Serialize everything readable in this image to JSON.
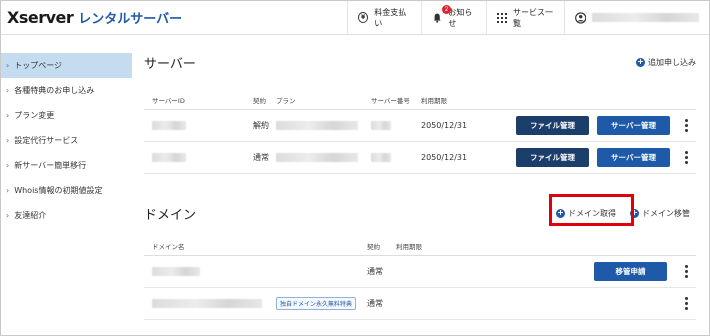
{
  "header": {
    "logo_main": "Xserver",
    "logo_service": "レンタルサーバー",
    "nav": [
      {
        "label": "料金支払い",
        "icon": "yen-circle-icon"
      },
      {
        "label": "お知らせ",
        "icon": "bell-icon",
        "badge": "2"
      },
      {
        "label": "サービス一覧",
        "icon": "grid-icon"
      }
    ],
    "user_icon": "user-circle-icon"
  },
  "sidebar": {
    "items": [
      {
        "label": "トップページ",
        "active": true
      },
      {
        "label": "各種特典のお申し込み"
      },
      {
        "label": "プラン変更"
      },
      {
        "label": "設定代行サービス"
      },
      {
        "label": "新サーバー簡単移行"
      },
      {
        "label": "Whois情報の初期値設定"
      },
      {
        "label": "友達紹介"
      }
    ]
  },
  "server_section": {
    "title": "サーバー",
    "add_link": "追加申し込み",
    "columns": [
      "サーバーID",
      "契約",
      "プラン",
      "サーバー番号",
      "利用期限"
    ],
    "rows": [
      {
        "contract": "解約",
        "expiry": "2050/12/31",
        "file_btn": "ファイル管理",
        "server_btn": "サーバー管理"
      },
      {
        "contract": "通常",
        "expiry": "2050/12/31",
        "file_btn": "ファイル管理",
        "server_btn": "サーバー管理"
      }
    ]
  },
  "domain_section": {
    "title": "ドメイン",
    "acquire_link": "ドメイン取得",
    "transfer_link": "ドメイン移管",
    "columns": [
      "ドメイン名",
      "契約",
      "利用期限"
    ],
    "rows": [
      {
        "contract": "通常",
        "button": "移管申請"
      },
      {
        "contract": "通常",
        "tag": "独自ドメイン永久無料特典"
      }
    ]
  },
  "colors": {
    "brand": "#1e5aa8",
    "dark_button": "#1b3e6a",
    "highlight": "#e0000b",
    "sidebar_active": "#c5dcf0"
  }
}
